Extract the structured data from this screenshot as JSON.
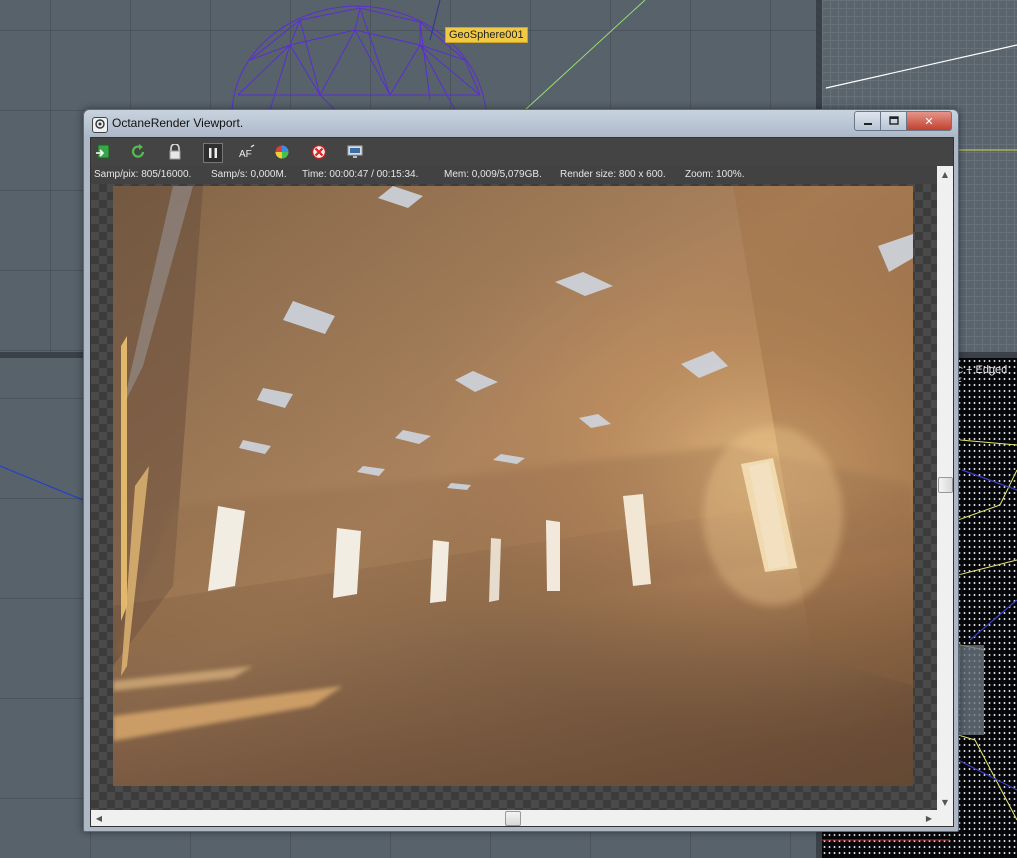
{
  "background": {
    "object_label": "GeoSphere001",
    "viewport_label": "ic + Edged F"
  },
  "window": {
    "title": "OctaneRender Viewport.",
    "app_icon": "octane-app-icon",
    "controls": {
      "minimize": "minimize-icon",
      "maximize": "maximize-icon",
      "close_symbol": "✕"
    }
  },
  "toolbar": {
    "buttons": [
      {
        "icon": "export-image-icon"
      },
      {
        "icon": "restart-render-icon"
      },
      {
        "icon": "lock-icon"
      },
      {
        "icon": "pause-icon"
      },
      {
        "icon": "autofocus-icon"
      },
      {
        "icon": "color-picker-icon"
      },
      {
        "icon": "stop-render-icon"
      },
      {
        "icon": "display-settings-icon"
      }
    ],
    "af_text": "AF"
  },
  "status": {
    "samples": "Samp/pix: 805/16000.",
    "rate": "Samp/s: 0,000M.",
    "time": "Time: 00:00:47 / 00:15:34.",
    "memory": "Mem: 0,009/5,079GB.",
    "render_size": "Render size: 800 x 600.",
    "zoom": "Zoom: 100%."
  },
  "scrollbars": {
    "up": "▲",
    "down": "▼",
    "left": "◀",
    "right": "▶"
  },
  "colors": {
    "render_warm": "#c49466",
    "render_shadow": "#7a5535",
    "wireframe": "#5a2fd0",
    "label_bg": "#f2c944"
  }
}
